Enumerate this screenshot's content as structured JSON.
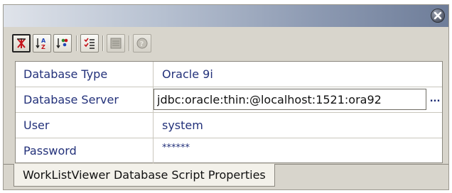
{
  "titlebar": {
    "close_icon": "close-icon"
  },
  "toolbar": {
    "buttons": [
      {
        "name": "categorized-icon",
        "state": "active"
      },
      {
        "name": "sort-alphabetical-icon",
        "state": "normal"
      },
      {
        "name": "sort-by-type-icon",
        "state": "normal"
      },
      {
        "name": "show-modified-icon",
        "state": "normal"
      },
      {
        "name": "property-pages-icon",
        "state": "disabled"
      },
      {
        "name": "help-icon",
        "state": "disabled"
      }
    ]
  },
  "properties": {
    "rows": [
      {
        "name": "Database Type",
        "value": "Oracle 9i"
      },
      {
        "name": "Database Server",
        "value": "jdbc:oracle:thin:@localhost:1521:ora92"
      },
      {
        "name": "User",
        "value": "system"
      },
      {
        "name": "Password",
        "value": "******"
      }
    ],
    "ellipsis_label": "..."
  },
  "tabs": [
    {
      "label": "WorkListViewer Database Script Properties"
    }
  ],
  "colors": {
    "accent": "#23317a",
    "panel": "#d8d5cc"
  }
}
